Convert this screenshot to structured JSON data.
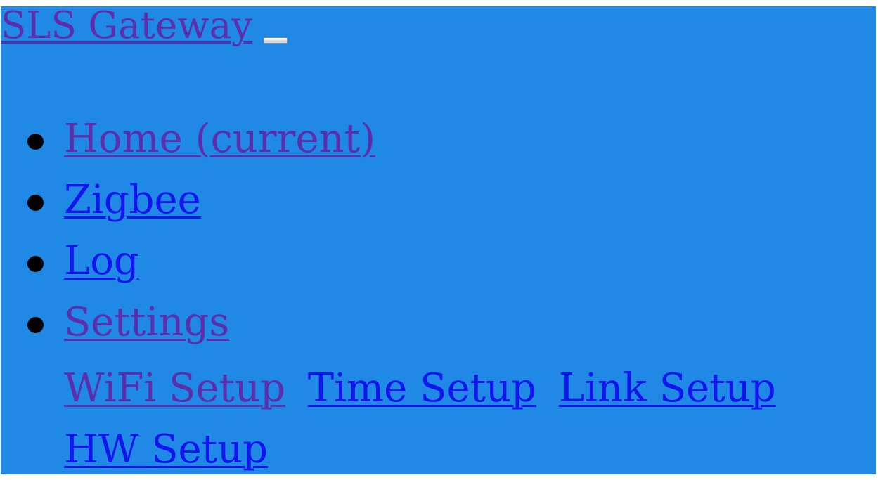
{
  "header": {
    "brand": "SLS Gateway",
    "toggler_icon": "menu-toggle-button"
  },
  "nav": {
    "items": [
      {
        "label": "Home (current)"
      },
      {
        "label": "Zigbee"
      },
      {
        "label": "Log"
      },
      {
        "label": "Settings"
      }
    ],
    "settings_submenu": [
      {
        "label": "WiFi Setup"
      },
      {
        "label": "Time Setup"
      },
      {
        "label": "Link Setup"
      },
      {
        "label": "HW Setup"
      }
    ]
  },
  "colors": {
    "background": "#1f89e5",
    "link_visited": "#5d2dab",
    "link_unvisited": "#1414ee"
  }
}
